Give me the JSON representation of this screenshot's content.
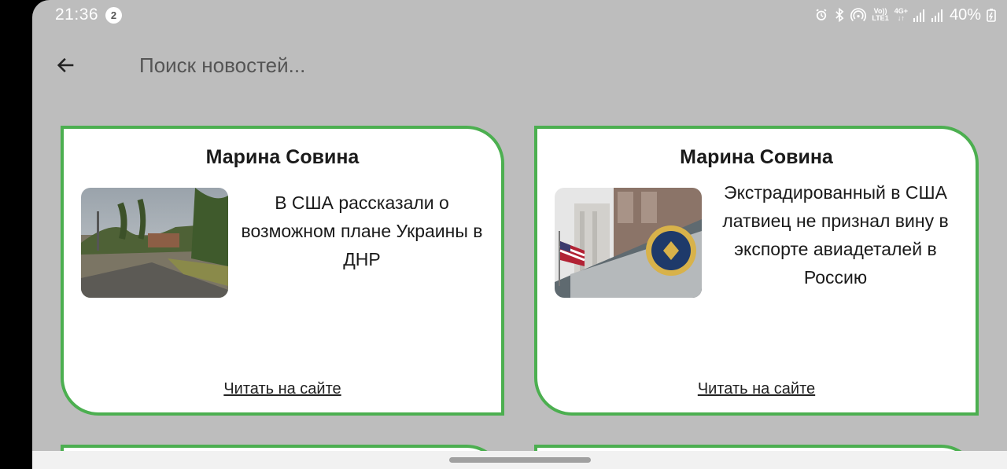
{
  "status_bar": {
    "time": "21:36",
    "notification_count": "2",
    "network_volte": "Vo))",
    "network_lte": "LTE1",
    "network_4g": "4G+",
    "battery": "40%"
  },
  "search": {
    "placeholder": "Поиск новостей..."
  },
  "cards": [
    {
      "author": "Марина Совина",
      "title": "В США рассказали о возможном плане Украины в ДНР",
      "link_label": "Читать на сайте"
    },
    {
      "author": "Марина Совина",
      "title": "Экстрадированный в США латвиец не признал вину в экспорте авиадеталей в Россию",
      "link_label": "Читать на сайте"
    }
  ],
  "colors": {
    "accent": "#4caf50",
    "background": "#bdbdbd",
    "card": "#ffffff"
  }
}
